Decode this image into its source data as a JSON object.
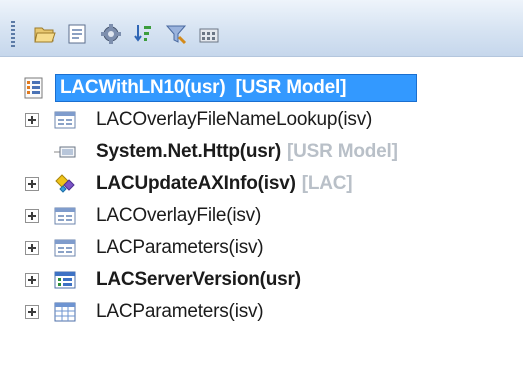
{
  "toolbar": {
    "icons": [
      "folder-open-icon",
      "document-icon",
      "settings-icon",
      "sort-icon",
      "filter-icon",
      "calculator-icon"
    ]
  },
  "tree": {
    "nodes": [
      {
        "label": "LACWithLN10(usr)",
        "tag": "[USR Model]",
        "bold": true,
        "selected": true,
        "expandable": false,
        "icon": "list-icon"
      },
      {
        "label": "LACOverlayFileNameLookup(isv)",
        "tag": "",
        "bold": false,
        "selected": false,
        "expandable": true,
        "icon": "form-icon"
      },
      {
        "label": "System.Net.Http(usr)",
        "tag": "[USR Model]",
        "bold": true,
        "selected": false,
        "expandable": false,
        "icon": "reference-icon"
      },
      {
        "label": "LACUpdateAXInfo(isv)",
        "tag": "[LAC]",
        "bold": true,
        "selected": false,
        "expandable": true,
        "icon": "class-icon"
      },
      {
        "label": "LACOverlayFile(isv)",
        "tag": "",
        "bold": false,
        "selected": false,
        "expandable": true,
        "icon": "form-icon"
      },
      {
        "label": "LACParameters(isv)",
        "tag": "",
        "bold": false,
        "selected": false,
        "expandable": true,
        "icon": "form-icon"
      },
      {
        "label": "LACServerVersion(usr)",
        "tag": "",
        "bold": true,
        "selected": false,
        "expandable": true,
        "icon": "enum-icon"
      },
      {
        "label": "LACParameters(isv)",
        "tag": "",
        "bold": false,
        "selected": false,
        "expandable": true,
        "icon": "table-icon"
      }
    ]
  }
}
